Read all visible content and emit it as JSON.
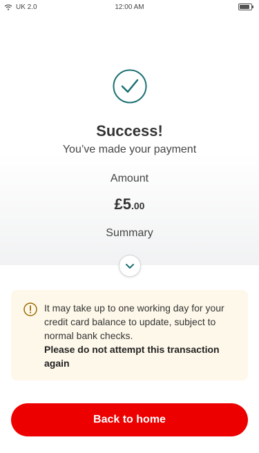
{
  "status_bar": {
    "carrier": "UK 2.0",
    "time": "12:00 AM",
    "battery_level": 0.9,
    "wifi_icon": "wifi-icon",
    "battery_icon": "battery-icon"
  },
  "confirmation": {
    "icon": "check-circle-icon",
    "title": "Success!",
    "subtitle": "You’ve made your payment",
    "amount_label": "Amount",
    "amount_major": "£5",
    "amount_minor": ".00",
    "summary_label": "Summary",
    "expand_icon": "chevron-down-icon"
  },
  "notice": {
    "icon": "warning-icon",
    "text": "It may take up to one working day for your credit card balance to update, subject to normal bank checks.",
    "bold_text": "Please do not attempt this transaction again"
  },
  "actions": {
    "home_label": "Back to home"
  },
  "colors": {
    "brand_red": "#ec0000",
    "success_teal": "#1b6f72",
    "warning_gold": "#9a6b00",
    "notice_bg": "#fef8ea"
  }
}
